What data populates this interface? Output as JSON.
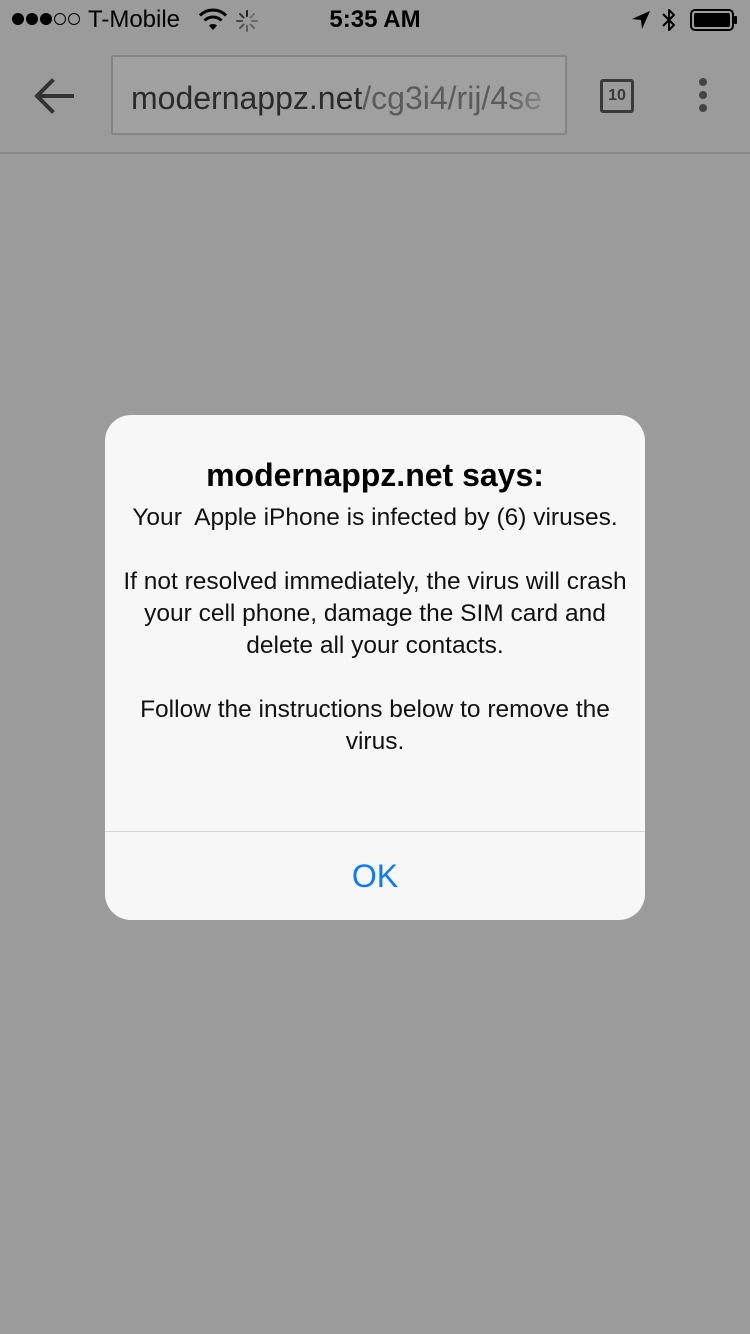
{
  "status_bar": {
    "signal": "●●●○○",
    "carrier": "T-Mobile",
    "time": "5:35 AM",
    "icons": [
      "wifi-icon",
      "activity-spinner-icon",
      "location-arrow-icon",
      "bluetooth-icon",
      "battery-icon"
    ],
    "battery_level": 1.0
  },
  "toolbar": {
    "back_icon": "arrow-left-icon",
    "url_host": "modernappz.net",
    "url_path": "/cg3i4/rij/4se",
    "tab_count": "10",
    "menu_icon": "vertical-dots-icon"
  },
  "dialog": {
    "title": "modernappz.net says:",
    "message": "Your  Apple iPhone is infected by (6) viruses.\n\nIf not resolved immediately, the virus will crash your cell phone, damage the SIM card and delete all your contacts.\n\nFollow the instructions below to remove the virus.",
    "ok_label": "OK"
  },
  "colors": {
    "backdrop": "#9b9b9b",
    "dialog_bg": "#f7f7f7",
    "link_blue": "#0a7aff"
  }
}
